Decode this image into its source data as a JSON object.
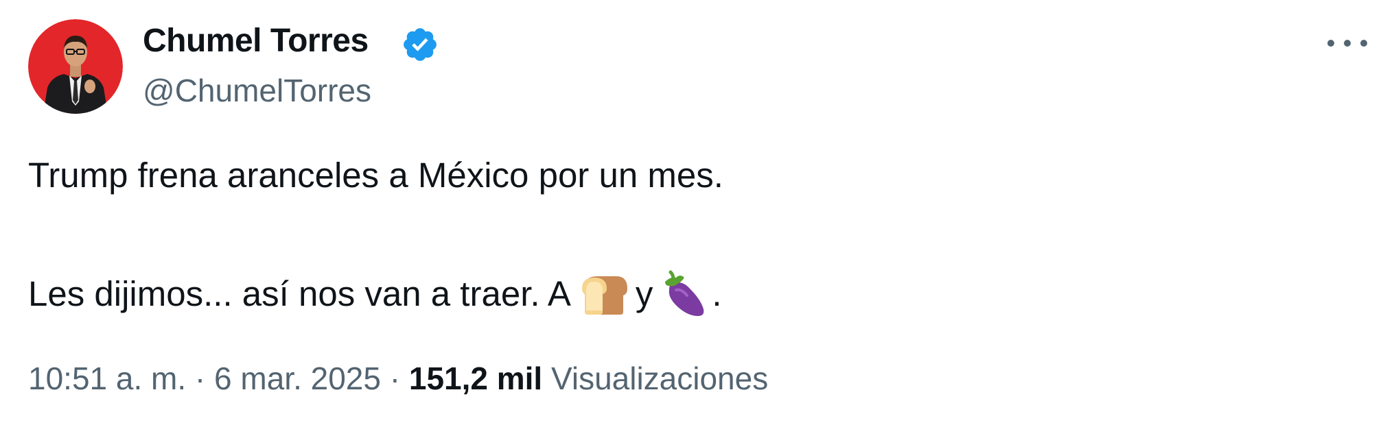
{
  "author": {
    "name": "Chumel Torres",
    "handle": "@ChumelTorres",
    "verified": true
  },
  "tweet": {
    "line1": "Trump frena aranceles a México por un mes.",
    "line2_part1": "Les dijimos... así nos van a traer. A",
    "emoji_1": "bread-icon",
    "line2_part2": "y",
    "emoji_2": "eggplant-icon",
    "line2_end": "."
  },
  "meta": {
    "time": "10:51 a. m.",
    "separator": "·",
    "date": "6 mar. 2025",
    "views_count": "151,2 mil",
    "views_label": "Visualizaciones"
  },
  "colors": {
    "accent_verified": "#1d9bf0",
    "avatar_background": "#e3262a",
    "text_primary": "#0f1419",
    "text_secondary": "#536471"
  }
}
